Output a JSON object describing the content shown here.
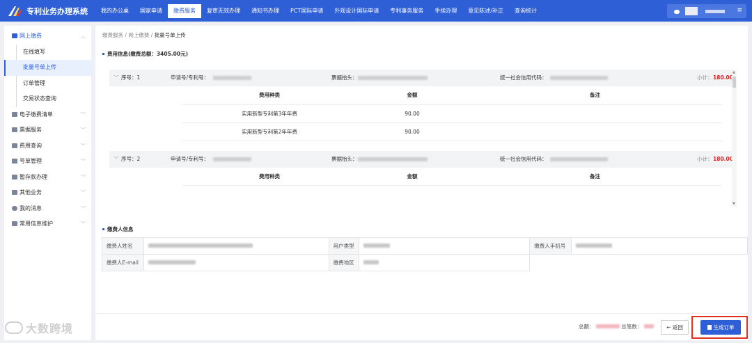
{
  "app": {
    "title": "专利业务办理系统"
  },
  "nav": [
    {
      "label": "我的办公桌"
    },
    {
      "label": "国家申请"
    },
    {
      "label": "缴费服务"
    },
    {
      "label": "复审无效办理"
    },
    {
      "label": "通知书办理"
    },
    {
      "label": "PCT国际申请"
    },
    {
      "label": "外观设计国际申请"
    },
    {
      "label": "专利事务服务"
    },
    {
      "label": "手续办理"
    },
    {
      "label": "意见陈述/补正"
    },
    {
      "label": "查询统计"
    }
  ],
  "user": {
    "menu_icon": "menu-icon",
    "menu_glyph": "≡"
  },
  "sidebar": {
    "group": {
      "label": "网上缴费",
      "chevron": "︿"
    },
    "sub": [
      {
        "label": "在线填写"
      },
      {
        "label": "批量号单上传"
      },
      {
        "label": "订单管理"
      },
      {
        "label": "交易状态查询"
      }
    ],
    "items": [
      {
        "label": "电子缴费清单",
        "chevron": "﹀"
      },
      {
        "label": "票据服务",
        "chevron": "﹀"
      },
      {
        "label": "费用查询",
        "chevron": "﹀"
      },
      {
        "label": "号单管理",
        "chevron": "﹀"
      },
      {
        "label": "暂存款办理",
        "chevron": "﹀"
      },
      {
        "label": "其他业务",
        "chevron": "﹀"
      },
      {
        "label": "我的消息",
        "chevron": "﹀"
      },
      {
        "label": "常用信息维护",
        "chevron": "﹀"
      }
    ]
  },
  "breadcrumb": {
    "a": "缴费服务",
    "sep": "/",
    "b": "网上缴费",
    "c": "批量号单上传"
  },
  "fee_section": {
    "title": "费用信息(缴费总额：3405.00元)"
  },
  "groups": [
    {
      "expand_glyph": "﹀",
      "seq_label": "序号：1",
      "app_label": "申请号/专利号：",
      "head_label": "票据抬头：",
      "credit_label": "统一社会信用代码：",
      "subtotal_label": "小计：",
      "subtotal": "180.00",
      "columns": [
        "费用种类",
        "金额",
        "备注"
      ],
      "rows": [
        {
          "type": "实用新型专利第3年年费",
          "amount": "90.00",
          "note": ""
        },
        {
          "type": "实用新型专利第2年年费",
          "amount": "90.00",
          "note": ""
        }
      ]
    },
    {
      "expand_glyph": "﹀",
      "seq_label": "序号：2",
      "app_label": "申请号/专利号：",
      "head_label": "票据抬头：",
      "credit_label": "统一社会信用代码：",
      "subtotal_label": "小计：",
      "subtotal": "180.00",
      "columns": [
        "费用种类",
        "金额",
        "备注"
      ]
    }
  ],
  "payer_section": {
    "title": "缴费人信息"
  },
  "payer": {
    "name_label": "缴费人姓名",
    "type_label": "用户类型",
    "phone_label": "缴费人手机号",
    "email_label": "缴费人E-mail",
    "region_label": "缴费地区"
  },
  "footer": {
    "total_label": "总额：",
    "count_label": "总笔数：",
    "back_label": "← 返回",
    "generate_label": "生成订单"
  },
  "watermark": "大数跨境",
  "colors": {
    "brand": "#2e5fd7",
    "amount": "#e02020",
    "highlight": "#e0301e"
  }
}
